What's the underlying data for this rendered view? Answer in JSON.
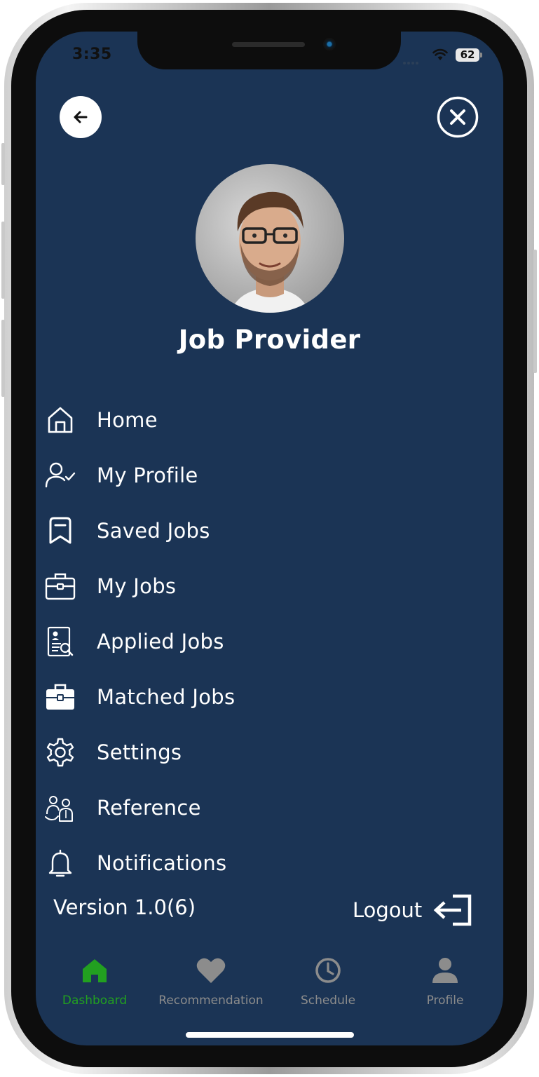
{
  "status_bar": {
    "time": "3:35",
    "battery": "62"
  },
  "header": {
    "back_icon": "arrow-left-icon",
    "close_icon": "close-circle-icon"
  },
  "profile": {
    "title": "Job Provider"
  },
  "menu": {
    "items": [
      {
        "label": "Home",
        "icon": "home-icon"
      },
      {
        "label": "My Profile",
        "icon": "user-check-icon"
      },
      {
        "label": "Saved Jobs",
        "icon": "bookmark-icon"
      },
      {
        "label": "My Jobs",
        "icon": "briefcase-outline-icon"
      },
      {
        "label": "Applied Jobs",
        "icon": "resume-search-icon"
      },
      {
        "label": "Matched Jobs",
        "icon": "briefcase-filled-icon"
      },
      {
        "label": "Settings",
        "icon": "gear-icon"
      },
      {
        "label": "Reference",
        "icon": "people-reference-icon"
      },
      {
        "label": "Notifications",
        "icon": "bell-icon"
      }
    ]
  },
  "footer": {
    "version": "Version 1.0(6)",
    "logout_label": "Logout",
    "logout_icon": "logout-icon"
  },
  "bottom_nav": {
    "items": [
      {
        "label": "Dashboard",
        "icon": "home-filled-icon",
        "active": true
      },
      {
        "label": "Recommendation",
        "icon": "heart-icon",
        "active": false
      },
      {
        "label": "Schedule",
        "icon": "clock-icon",
        "active": false
      },
      {
        "label": "Profile",
        "icon": "person-icon",
        "active": false
      }
    ]
  },
  "colors": {
    "background": "#1b3455",
    "active_tab": "#22a020",
    "inactive_tab": "#8c8c8c",
    "text": "#ffffff"
  }
}
